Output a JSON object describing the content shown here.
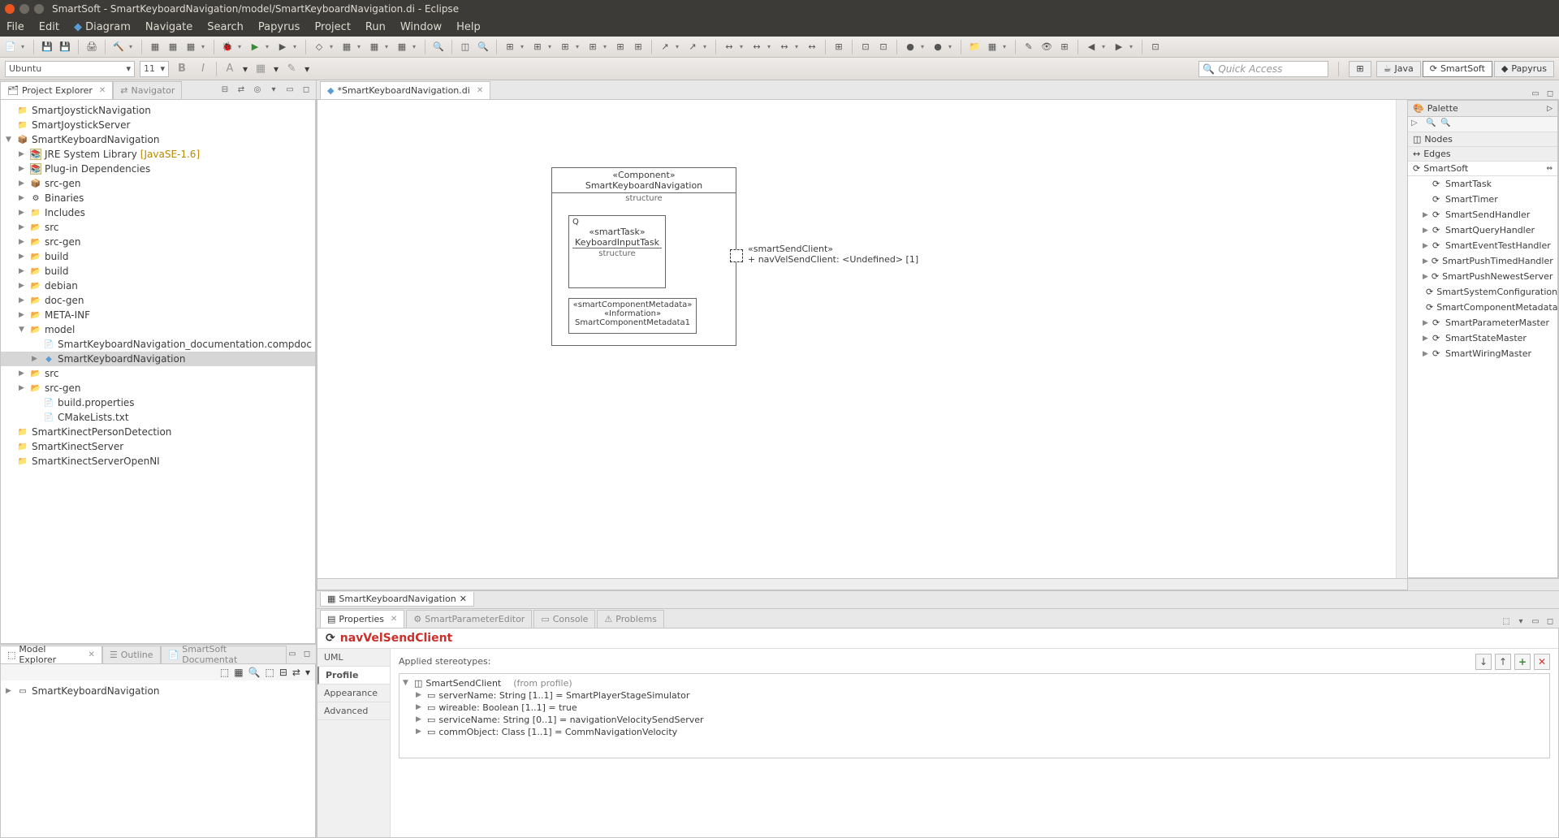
{
  "window_title": "SmartSoft - SmartKeyboardNavigation/model/SmartKeyboardNavigation.di - Eclipse",
  "menubar": [
    "File",
    "Edit",
    "Diagram",
    "Navigate",
    "Search",
    "Papyrus",
    "Project",
    "Run",
    "Window",
    "Help"
  ],
  "formatbar": {
    "font": "Ubuntu",
    "size": "11"
  },
  "quick_access_placeholder": "Quick Access",
  "perspectives": [
    "Java",
    "SmartSoft",
    "Papyrus"
  ],
  "active_perspective": "SmartSoft",
  "project_explorer": {
    "title": "Project Explorer",
    "other_tab": "Navigator",
    "tree": [
      {
        "indent": 0,
        "arrow": "",
        "icon": "folder",
        "label": "SmartJoystickNavigation"
      },
      {
        "indent": 0,
        "arrow": "",
        "icon": "folder",
        "label": "SmartJoystickServer"
      },
      {
        "indent": 0,
        "arrow": "▼",
        "icon": "pkg",
        "label": "SmartKeyboardNavigation"
      },
      {
        "indent": 1,
        "arrow": "▶",
        "icon": "lib",
        "label": "JRE System Library",
        "suffix": "[JavaSE-1.6]"
      },
      {
        "indent": 1,
        "arrow": "▶",
        "icon": "lib",
        "label": "Plug-in Dependencies"
      },
      {
        "indent": 1,
        "arrow": "▶",
        "icon": "pkg-src",
        "label": "src-gen"
      },
      {
        "indent": 1,
        "arrow": "▶",
        "icon": "bin",
        "label": "Binaries"
      },
      {
        "indent": 1,
        "arrow": "▶",
        "icon": "inc",
        "label": "Includes"
      },
      {
        "indent": 1,
        "arrow": "▶",
        "icon": "folder-open",
        "label": "src"
      },
      {
        "indent": 1,
        "arrow": "▶",
        "icon": "folder-open",
        "label": "src-gen"
      },
      {
        "indent": 1,
        "arrow": "▶",
        "icon": "folder-open",
        "label": "build"
      },
      {
        "indent": 1,
        "arrow": "▶",
        "icon": "folder-open",
        "label": "build"
      },
      {
        "indent": 1,
        "arrow": "▶",
        "icon": "folder-open",
        "label": "debian"
      },
      {
        "indent": 1,
        "arrow": "▶",
        "icon": "folder-open",
        "label": "doc-gen"
      },
      {
        "indent": 1,
        "arrow": "▶",
        "icon": "folder-open",
        "label": "META-INF"
      },
      {
        "indent": 1,
        "arrow": "▼",
        "icon": "folder-open",
        "label": "model"
      },
      {
        "indent": 2,
        "arrow": "",
        "icon": "file",
        "label": "SmartKeyboardNavigation_documentation.compdoc"
      },
      {
        "indent": 2,
        "arrow": "▶",
        "icon": "model",
        "label": "SmartKeyboardNavigation",
        "selected": true
      },
      {
        "indent": 1,
        "arrow": "▶",
        "icon": "folder-open",
        "label": "src"
      },
      {
        "indent": 1,
        "arrow": "▶",
        "icon": "folder-open",
        "label": "src-gen"
      },
      {
        "indent": 2,
        "arrow": "",
        "icon": "file",
        "label": "build.properties"
      },
      {
        "indent": 2,
        "arrow": "",
        "icon": "file",
        "label": "CMakeLists.txt"
      },
      {
        "indent": 0,
        "arrow": "",
        "icon": "folder",
        "label": "SmartKinectPersonDetection"
      },
      {
        "indent": 0,
        "arrow": "",
        "icon": "folder",
        "label": "SmartKinectServer"
      },
      {
        "indent": 0,
        "arrow": "",
        "icon": "folder",
        "label": "SmartKinectServerOpenNI"
      }
    ]
  },
  "model_explorer": {
    "title": "Model Explorer",
    "tabs": [
      "Outline",
      "SmartSoft Documentat"
    ],
    "tree_root": "SmartKeyboardNavigation"
  },
  "editor": {
    "tab_label": "*SmartKeyboardNavigation.di",
    "bottom_tab": "SmartKeyboardNavigation"
  },
  "diagram": {
    "component_stereotype": "«Component»",
    "component_name": "SmartKeyboardNavigation",
    "component_sub": "structure",
    "task_stereotype": "«smartTask»",
    "task_name": "KeyboardInputTask",
    "task_sub": "structure",
    "meta_stereotype": "«smartComponentMetadata»",
    "meta_info": "«Information»",
    "meta_name": "SmartComponentMetadata1",
    "port_stereotype": "«smartSendClient»",
    "port_label": "+ navVelSendClient: <Undefined> [1]"
  },
  "palette": {
    "title": "Palette",
    "sections": [
      "Nodes",
      "Edges"
    ],
    "group": "SmartSoft",
    "items": [
      {
        "arrow": "",
        "label": "SmartTask"
      },
      {
        "arrow": "",
        "label": "SmartTimer"
      },
      {
        "arrow": "▶",
        "label": "SmartSendHandler"
      },
      {
        "arrow": "▶",
        "label": "SmartQueryHandler"
      },
      {
        "arrow": "▶",
        "label": "SmartEventTestHandler"
      },
      {
        "arrow": "▶",
        "label": "SmartPushTimedHandler"
      },
      {
        "arrow": "▶",
        "label": "SmartPushNewestServer"
      },
      {
        "arrow": "",
        "label": "SmartSystemConfiguration"
      },
      {
        "arrow": "",
        "label": "SmartComponentMetadata"
      },
      {
        "arrow": "▶",
        "label": "SmartParameterMaster"
      },
      {
        "arrow": "▶",
        "label": "SmartStateMaster"
      },
      {
        "arrow": "▶",
        "label": "SmartWiringMaster"
      }
    ]
  },
  "properties": {
    "tabs": [
      "Properties",
      "SmartParameterEditor",
      "Console",
      "Problems"
    ],
    "title": "navVelSendClient",
    "side_tabs": [
      "UML",
      "Profile",
      "Appearance",
      "Advanced"
    ],
    "active_side_tab": "Profile",
    "applied_label": "Applied stereotypes:",
    "stereotype_root": "SmartSendClient",
    "stereotype_root_suffix": "(from profile)",
    "stereotype_props": [
      "serverName: String [1..1] = SmartPlayerStageSimulator",
      "wireable: Boolean [1..1] = true",
      "serviceName: String [0..1] = navigationVelocitySendServer",
      "commObject: Class [1..1] = CommNavigationVelocity"
    ]
  }
}
